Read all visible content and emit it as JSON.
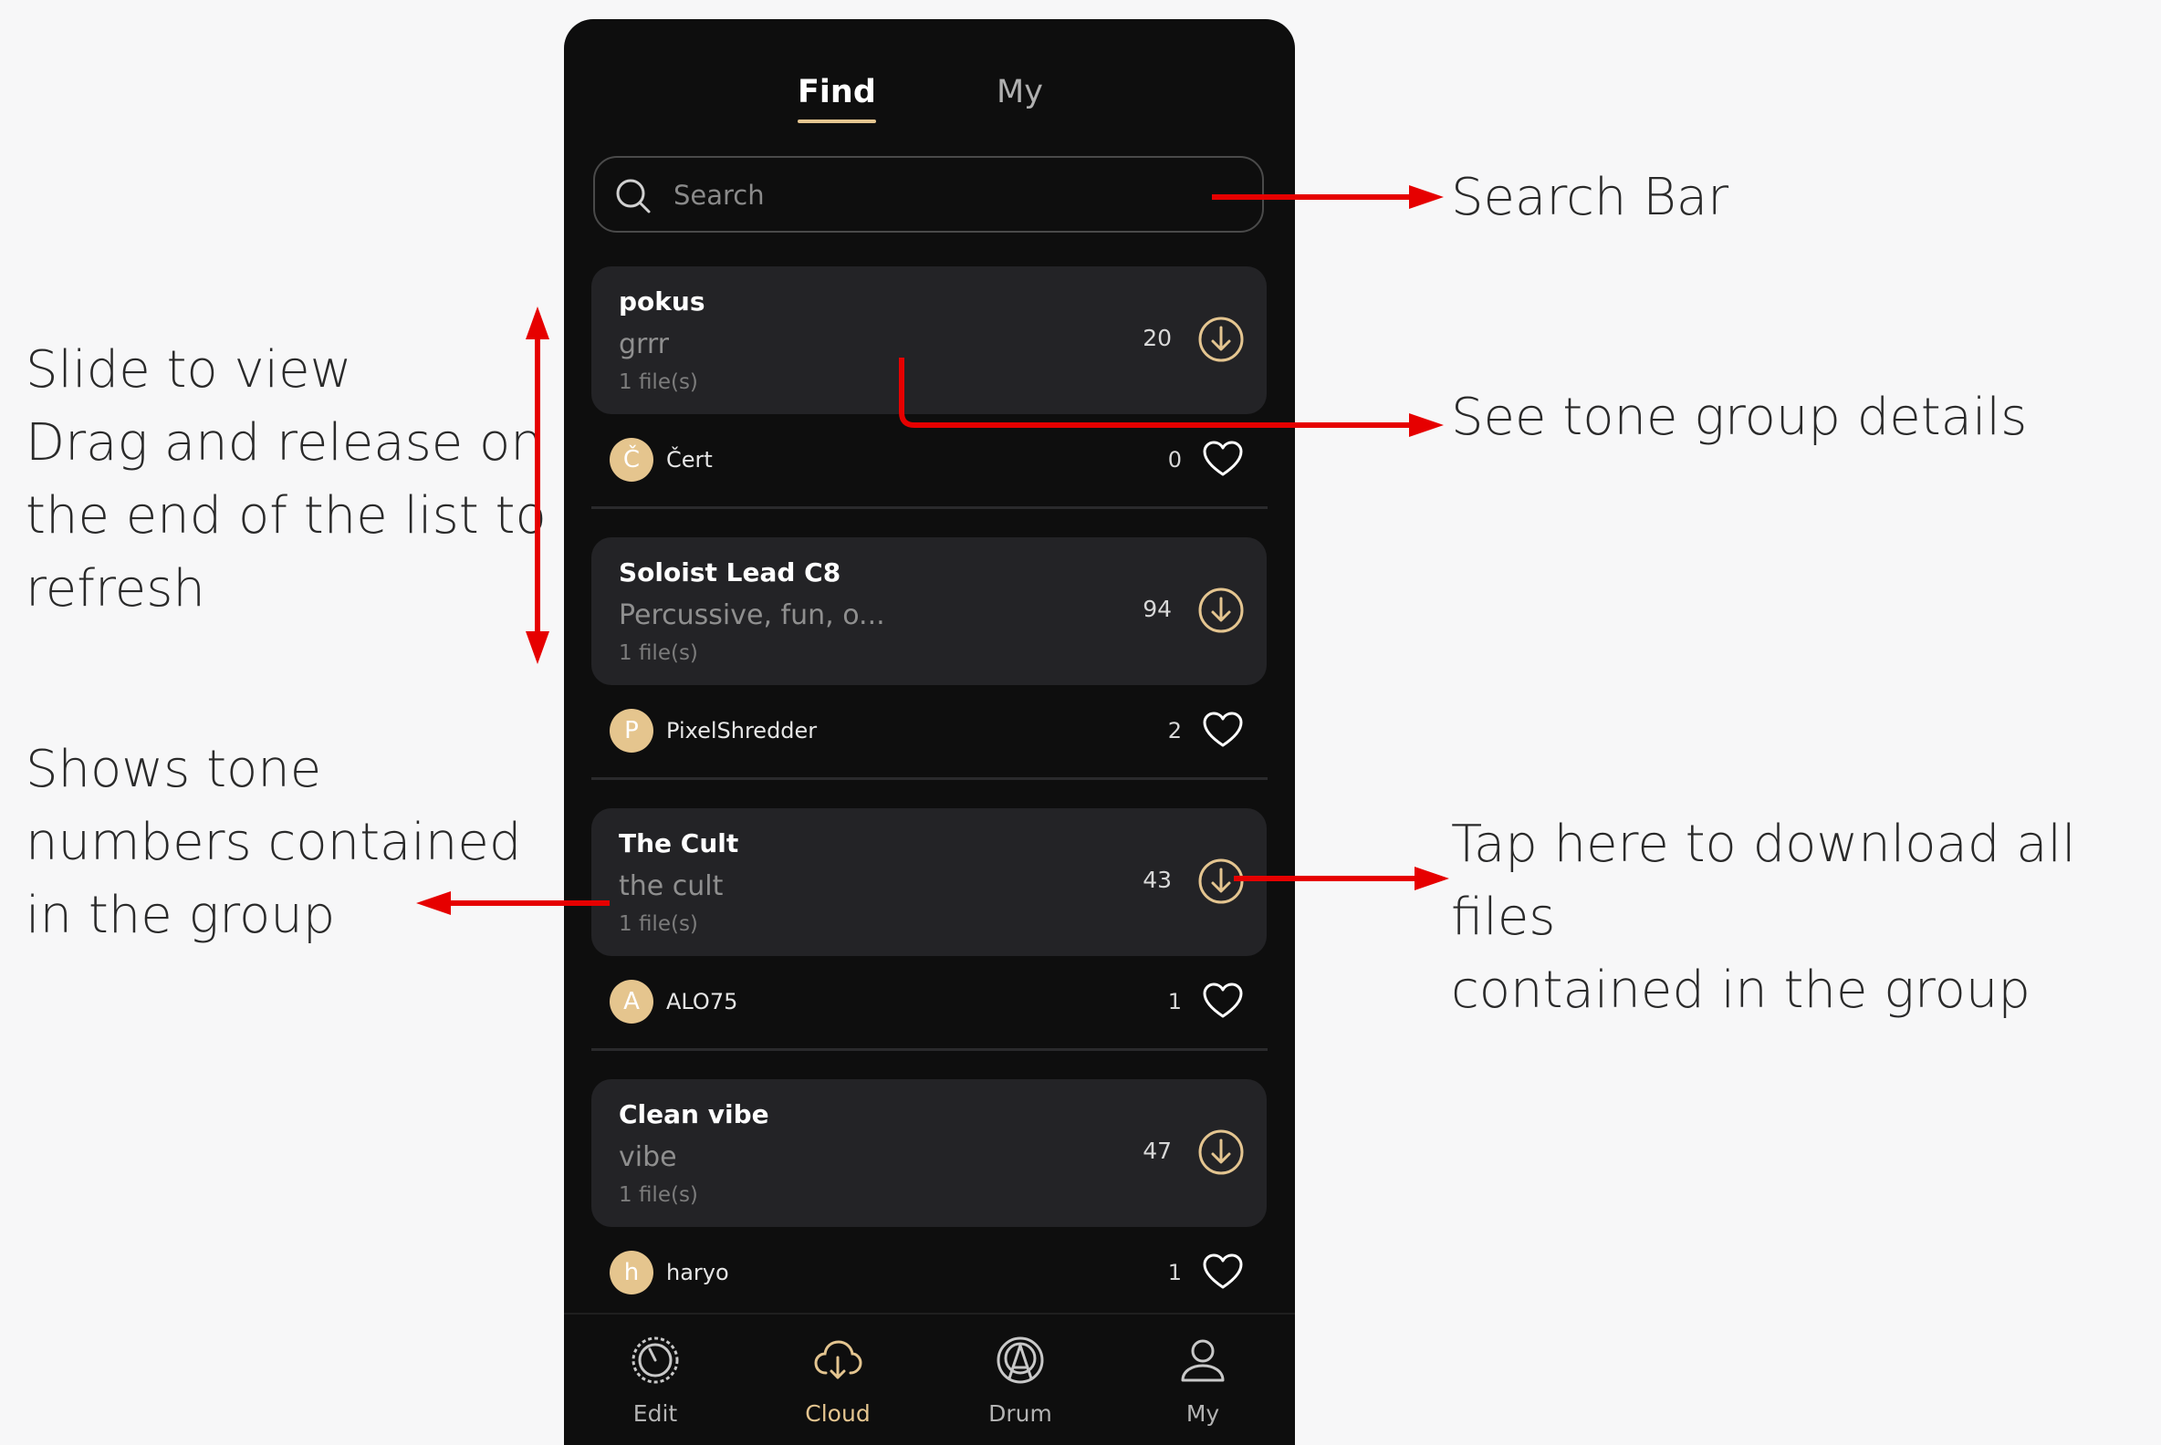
{
  "tabs": {
    "find": "Find",
    "my": "My"
  },
  "search": {
    "placeholder": "Search"
  },
  "groups": [
    {
      "title": "pokus",
      "desc": "grrr",
      "files": "1 file(s)",
      "count": "20",
      "author": "Čert",
      "author_initial": "Č",
      "likes": "0"
    },
    {
      "title": "Soloist Lead C8",
      "desc": "Percussive, fun, o...",
      "files": "1 file(s)",
      "count": "94",
      "author": "PixelShredder",
      "author_initial": "P",
      "likes": "2"
    },
    {
      "title": "The Cult",
      "desc": "the cult",
      "files": "1 file(s)",
      "count": "43",
      "author": "ALO75",
      "author_initial": "A",
      "likes": "1"
    },
    {
      "title": "Clean vibe",
      "desc": "vibe",
      "files": "1 file(s)",
      "count": "47",
      "author": "haryo",
      "author_initial": "h",
      "likes": "1"
    }
  ],
  "bottom_nav": {
    "items": [
      {
        "label": "Edit",
        "icon": "edit-icon"
      },
      {
        "label": "Cloud",
        "icon": "cloud-icon"
      },
      {
        "label": "Drum",
        "icon": "drum-icon"
      },
      {
        "label": "My",
        "icon": "person-icon"
      }
    ],
    "active": "Cloud"
  },
  "annotations": {
    "search_bar": "Search Bar",
    "details": "See tone group details",
    "slide_lines": [
      "Slide to view",
      "Drag and release on",
      "the end of the list to",
      "refresh"
    ],
    "numbers_lines": [
      "Shows tone",
      "numbers contained",
      "in the group"
    ],
    "download_lines": [
      "Tap here to download all files",
      "contained in the group"
    ]
  },
  "colors": {
    "accent": "#e4c590",
    "annotation_arrow": "#e60000",
    "phone_bg": "#0e0e0e",
    "card_bg": "#232326"
  }
}
